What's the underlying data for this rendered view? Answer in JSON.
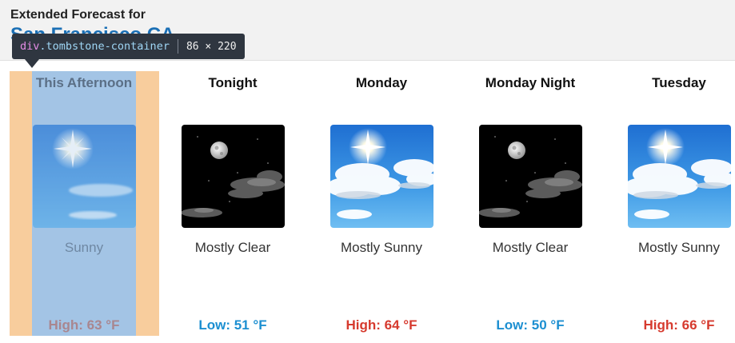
{
  "header": {
    "title": "Extended Forecast for",
    "location": "San Francisco CA"
  },
  "inspector_tooltip": {
    "tag": "div",
    "class_name": ".tombstone-container",
    "dimensions": "86 × 220"
  },
  "forecast": [
    {
      "period": "This Afternoon",
      "icon": "sunny-icon",
      "description": "Sunny",
      "temp": "High: 63 °F",
      "temp_kind": "high"
    },
    {
      "period": "Tonight",
      "icon": "night-clear-icon",
      "description": "Mostly Clear",
      "temp": "Low: 51 °F",
      "temp_kind": "low"
    },
    {
      "period": "Monday",
      "icon": "mostly-sunny-icon",
      "description": "Mostly Sunny",
      "temp": "High: 64 °F",
      "temp_kind": "high"
    },
    {
      "period": "Monday Night",
      "icon": "night-clear-icon",
      "description": "Mostly Clear",
      "temp": "Low: 50 °F",
      "temp_kind": "low"
    },
    {
      "period": "Tuesday",
      "icon": "mostly-sunny-icon",
      "description": "Mostly Sunny",
      "temp": "High: 66 °F",
      "temp_kind": "high"
    }
  ],
  "colors": {
    "high": "#d63a2e",
    "low": "#1c8fd1",
    "high_highlighted": "#a9868f"
  }
}
